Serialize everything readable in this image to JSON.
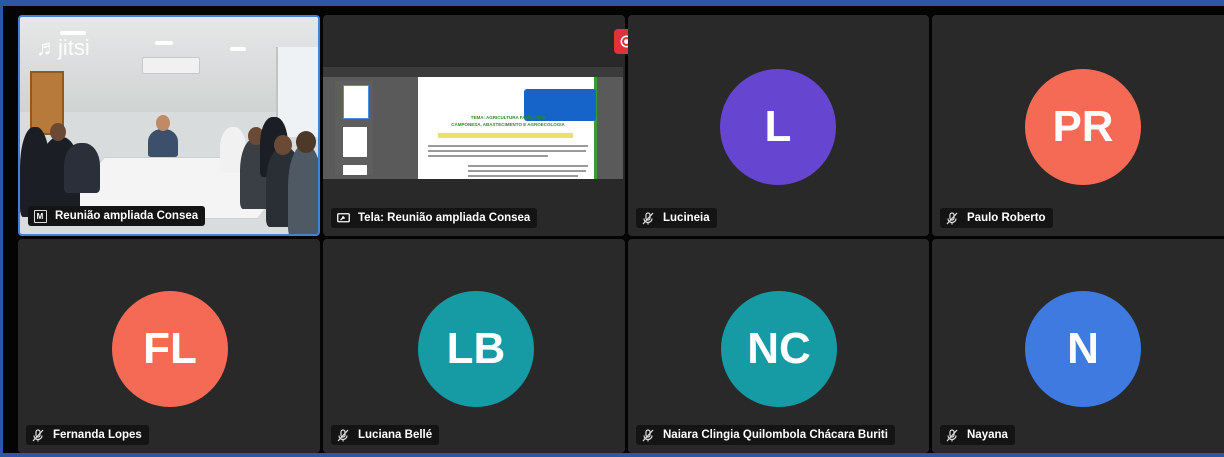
{
  "branding": {
    "logo_text": "jitsi"
  },
  "participants": [
    {
      "id": "camera",
      "name": "Reunião ampliada Consea",
      "badge": "M"
    },
    {
      "id": "screenshare",
      "name": "Tela: Reunião ampliada Consea"
    },
    {
      "id": "lucineia",
      "name": "Lucineia",
      "initials": "L",
      "color": "#6645d0"
    },
    {
      "id": "paulo",
      "name": "Paulo Roberto",
      "initials": "PR",
      "color": "#f56a55"
    },
    {
      "id": "fernanda",
      "name": "Fernanda Lopes",
      "initials": "FL",
      "color": "#f56a55"
    },
    {
      "id": "luciana",
      "name": "Luciana Bellé",
      "initials": "LB",
      "color": "#169ba4"
    },
    {
      "id": "naiara",
      "name": "Naiara Clingia Quilombola Chácara Buriti",
      "initials": "NC",
      "color": "#169ba4"
    },
    {
      "id": "nayana",
      "name": "Nayana",
      "initials": "N",
      "color": "#3f7ae0"
    }
  ],
  "shared_document": {
    "title_lines": [
      "TEMA: AGRICULTURA FAMILIAR E",
      "CAMPONESA, ABASTECIMENTO E AGROECOLOGIA"
    ]
  },
  "recording": {
    "active": true,
    "color": "#e0323a"
  }
}
